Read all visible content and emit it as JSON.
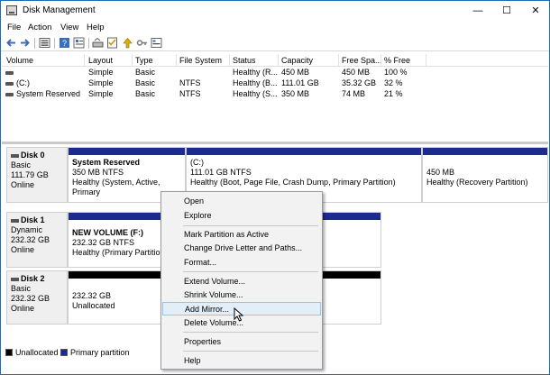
{
  "window": {
    "title": "Disk Management",
    "minimize": "—",
    "maximize": "☐",
    "close": "✕"
  },
  "menu": [
    "File",
    "Action",
    "View",
    "Help"
  ],
  "toolbar_icons": [
    "back-icon",
    "forward-icon",
    "disk-list-icon",
    "help-icon",
    "properties-icon",
    "rescan-icon",
    "checklist-icon",
    "arrow-up-icon",
    "key-icon",
    "settings-icon"
  ],
  "volumes": {
    "headers": [
      "Volume",
      "Layout",
      "Type",
      "File System",
      "Status",
      "Capacity",
      "Free Spa...",
      "% Free"
    ],
    "rows": [
      [
        "",
        "Simple",
        "Basic",
        "",
        "Healthy (R...",
        "450 MB",
        "450 MB",
        "100 %"
      ],
      [
        "(C:)",
        "Simple",
        "Basic",
        "NTFS",
        "Healthy (B...",
        "111.01 GB",
        "35.32 GB",
        "32 %"
      ],
      [
        "System Reserved",
        "Simple",
        "Basic",
        "NTFS",
        "Healthy (S...",
        "350 MB",
        "74 MB",
        "21 %"
      ]
    ]
  },
  "disks": [
    {
      "name": "Disk 0",
      "type": "Basic",
      "size": "111.79 GB",
      "status": "Online"
    },
    {
      "name": "Disk 1",
      "type": "Dynamic",
      "size": "232.32 GB",
      "status": "Online"
    },
    {
      "name": "Disk  2",
      "type": "Basic",
      "size": "232.32 GB",
      "status": "Online"
    }
  ],
  "partitions": {
    "disk0": [
      {
        "name": "System Reserved",
        "size": "350 MB NTFS",
        "status": "Healthy (System, Active, Primary"
      },
      {
        "name": "(C:)",
        "size": "111.01 GB NTFS",
        "status": "Healthy (Boot, Page File, Crash Dump, Primary Partition)"
      },
      {
        "name": "",
        "size": "450 MB",
        "status": "Healthy (Recovery Partition)"
      }
    ],
    "disk1": [
      {
        "name": "NEW VOLUME  (F:)",
        "size": "232.32 GB NTFS",
        "status": "Healthy (Primary Partition"
      }
    ],
    "disk2": [
      {
        "name": "",
        "size": "232.32  GB",
        "status": "Unallocated"
      }
    ]
  },
  "legend": {
    "unallocated": "Unallocated",
    "primary": "Primary partition",
    "unallocated_color": "#000000",
    "primary_color": "#1d2b8f"
  },
  "context_menu": {
    "open": "Open",
    "explore": "Explore",
    "mark_active": "Mark Partition as Active",
    "change_letter": "Change Drive Letter and Paths...",
    "format": "Format...",
    "extend": "Extend Volume...",
    "shrink": "Shrink Volume...",
    "add_mirror": "Add Mirror...",
    "delete": "Delete Volume...",
    "properties": "Properties",
    "help": "Help"
  }
}
